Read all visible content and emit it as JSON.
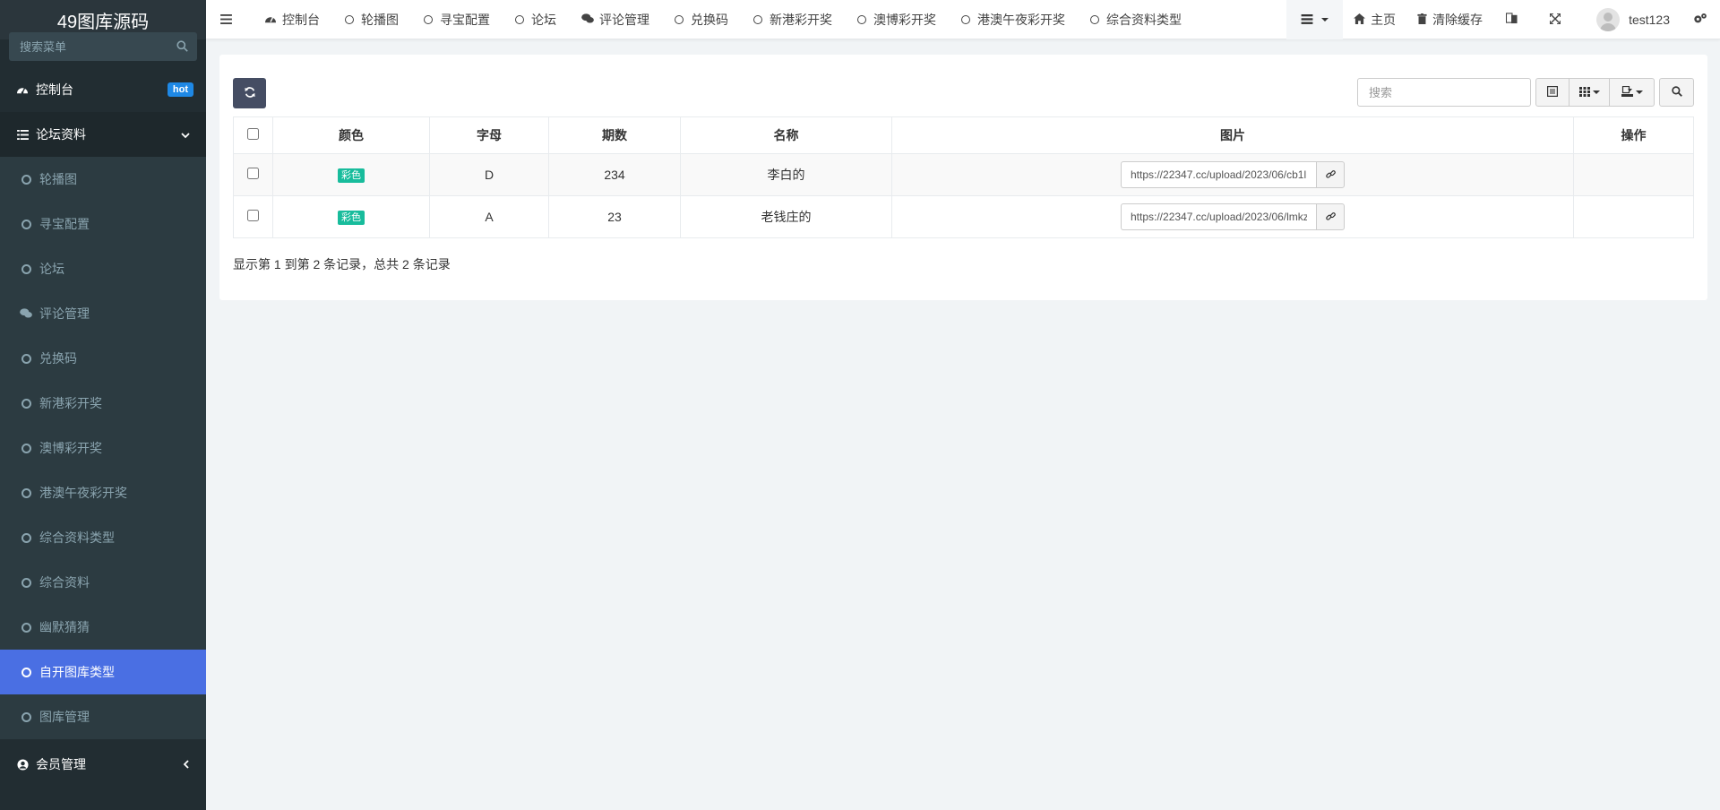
{
  "sidebar": {
    "logo": "49图库源码",
    "search_placeholder": "搜索菜单",
    "dashboard": {
      "label": "控制台",
      "badge": "hot"
    },
    "forum_data": {
      "label": "论坛资料"
    },
    "items": [
      {
        "label": "轮播图"
      },
      {
        "label": "寻宝配置"
      },
      {
        "label": "论坛"
      },
      {
        "label": "评论管理"
      },
      {
        "label": "兑换码"
      },
      {
        "label": "新港彩开奖"
      },
      {
        "label": "澳博彩开奖"
      },
      {
        "label": "港澳午夜彩开奖"
      },
      {
        "label": "综合资料类型"
      },
      {
        "label": "综合资料"
      },
      {
        "label": "幽默猜猜"
      },
      {
        "label": "自开图库类型"
      },
      {
        "label": "图库管理"
      }
    ],
    "member": {
      "label": "会员管理"
    },
    "accent_color": "#4a6fe3"
  },
  "topbar": {
    "tabs": [
      {
        "label": "控制台"
      },
      {
        "label": "轮播图"
      },
      {
        "label": "寻宝配置"
      },
      {
        "label": "论坛"
      },
      {
        "label": "评论管理"
      },
      {
        "label": "兑换码"
      },
      {
        "label": "新港彩开奖"
      },
      {
        "label": "澳博彩开奖"
      },
      {
        "label": "港澳午夜彩开奖"
      },
      {
        "label": "综合资料类型"
      }
    ],
    "home": "主页",
    "clear_cache": "清除缓存",
    "username": "test123"
  },
  "toolbar": {
    "search_placeholder": "搜索"
  },
  "table": {
    "headers": {
      "color": "颜色",
      "letter": "字母",
      "period": "期数",
      "name": "名称",
      "image": "图片",
      "actions": "操作"
    },
    "rows": [
      {
        "color": "彩色",
        "letter": "D",
        "period": "234",
        "name": "李白的",
        "image": "https://22347.cc/upload/2023/06/cb1l"
      },
      {
        "color": "彩色",
        "letter": "A",
        "period": "23",
        "name": "老钱庄的",
        "image": "https://22347.cc/upload/2023/06/lmkz"
      }
    ]
  },
  "pager": {
    "summary": "显示第 1 到第 2 条记录，总共 2 条记录"
  }
}
